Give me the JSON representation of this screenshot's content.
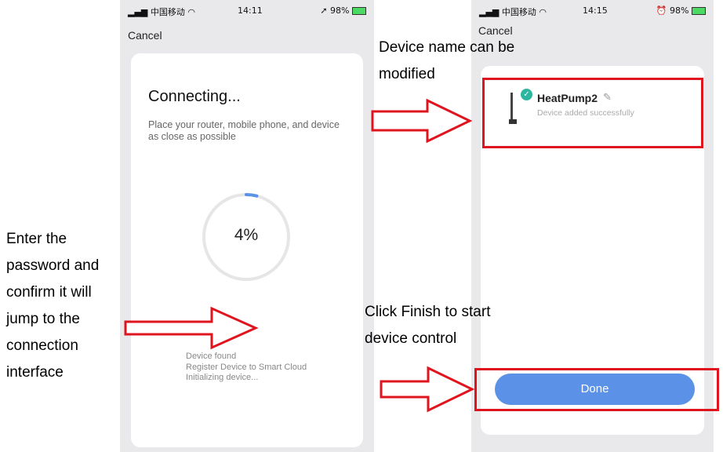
{
  "phone1": {
    "status": {
      "carrier": "中国移动",
      "time": "14:11",
      "battery": "98%"
    },
    "cancel": "Cancel",
    "title": "Connecting...",
    "description": "Place your router, mobile phone, and device as close as possible",
    "progress_label": "4%",
    "progress_value": 0.04,
    "steps": [
      "Device found",
      "Register Device to Smart Cloud",
      "Initializing device..."
    ]
  },
  "phone2": {
    "status": {
      "carrier": "中国移动",
      "time": "14:15",
      "battery": "98%"
    },
    "cancel": "Cancel",
    "device_name": "HeatPump2",
    "device_status": "Device added successfully",
    "done_label": "Done"
  },
  "annotations": {
    "left_note": [
      "Enter the",
      "password and",
      "confirm it will",
      "jump to the",
      "connection",
      "interface"
    ],
    "top_note": [
      "Device name can be",
      "modified"
    ],
    "bottom_note": [
      "Click Finish to start",
      "device control"
    ]
  },
  "colors": {
    "accent": "#5b92e8",
    "highlight": "#e0141e",
    "success": "#2db5a0"
  }
}
